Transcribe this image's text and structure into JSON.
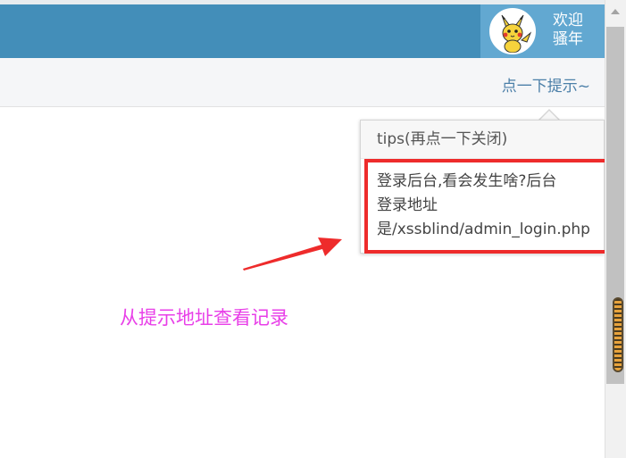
{
  "header": {
    "welcome_line1": "欢迎",
    "welcome_line2": "骚年",
    "avatar_icon": "pikachu-avatar-icon",
    "background": "#438eb9",
    "user_box_background": "#62a8d1"
  },
  "subbar": {
    "hint_link": "点一下提示~"
  },
  "popover": {
    "title": "tips(再点一下关闭)",
    "body_lines": [
      "登录后台,看会发生啥?后台",
      "登录地址",
      "是/xssblind/admin_login.php"
    ]
  },
  "annotation": {
    "text": "从提示地址查看记录",
    "color": "#e83fe8",
    "arrow_color": "#ee2b2b",
    "highlight_color": "#ee2b2b"
  }
}
